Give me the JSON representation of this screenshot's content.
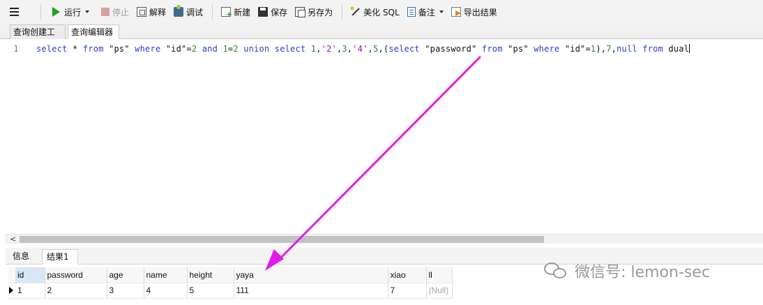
{
  "toolbar": {
    "run": "运行",
    "stop": "停止",
    "explain": "解释",
    "debug": "调试",
    "new": "新建",
    "save": "保存",
    "save_as": "另存为",
    "beautify": "美化 SQL",
    "notes": "备注",
    "export": "导出结果"
  },
  "editor_tabs": [
    "查询创建工具",
    "查询编辑器"
  ],
  "editor": {
    "line_number": "1",
    "sql": "select * from \"ps\" where \"id\"=2 and 1=2 union select 1,'2',3,'4',5,(select \"password\" from \"ps\" where \"id\"=1),7,null from dual"
  },
  "result_tabs": [
    "信息",
    "结果1"
  ],
  "result": {
    "columns": [
      "id",
      "password",
      "age",
      "name",
      "height",
      "yaya",
      "xiao",
      "ll"
    ],
    "rows": [
      [
        "1",
        "2",
        "3",
        "4",
        "5",
        "111",
        "7",
        "(Null)"
      ]
    ]
  },
  "watermark": "微信号: lemon-sec",
  "colors": {
    "annotation_arrow": "#e21ce8",
    "keyword": "#2e3ec9",
    "string": "#8b1ad6",
    "number": "#2a8a2a"
  },
  "icons": [
    "menu-icon",
    "run-icon",
    "stop-icon",
    "explain-icon",
    "debug-icon",
    "new-icon",
    "save-icon",
    "save-as-icon",
    "beautify-icon",
    "notes-icon",
    "export-icon",
    "wechat-icon"
  ]
}
